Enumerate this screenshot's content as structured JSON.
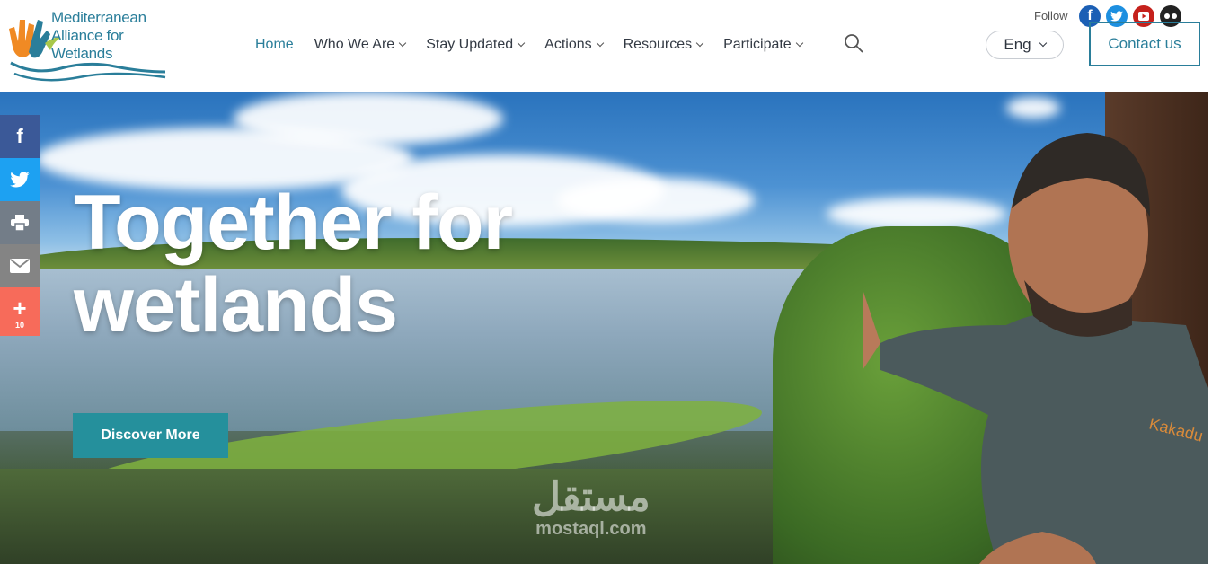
{
  "logo": {
    "line1": "Mediterranean",
    "line2": "Alliance for",
    "line3": "Wetlands"
  },
  "nav": {
    "items": [
      {
        "label": "Home",
        "active": true,
        "dropdown": false
      },
      {
        "label": "Who We Are",
        "active": false,
        "dropdown": true
      },
      {
        "label": "Stay Updated",
        "active": false,
        "dropdown": true
      },
      {
        "label": "Actions",
        "active": false,
        "dropdown": true
      },
      {
        "label": "Resources",
        "active": false,
        "dropdown": true
      },
      {
        "label": "Participate",
        "active": false,
        "dropdown": true
      }
    ],
    "search_icon": "search-icon"
  },
  "social": {
    "follow_label": "Follow",
    "icons": [
      "facebook-icon",
      "twitter-icon",
      "youtube-icon",
      "flickr-icon"
    ]
  },
  "language": {
    "current": "Eng"
  },
  "contact_label": "Contact us",
  "hero": {
    "title_line1": "Together for",
    "title_line2": "wetlands",
    "cta_label": "Discover More"
  },
  "share_bar": {
    "buttons": [
      "facebook-icon",
      "twitter-icon",
      "print-icon",
      "email-icon",
      "plus-icon"
    ],
    "more_count": "10"
  },
  "watermark": {
    "arabic": "مستقل",
    "latin": "mostaql.com"
  },
  "colors": {
    "brand": "#2a7e9a",
    "cta": "#25909c",
    "facebook": "#3b5998",
    "twitter": "#1da1f2",
    "share_more": "#f76b5a"
  }
}
